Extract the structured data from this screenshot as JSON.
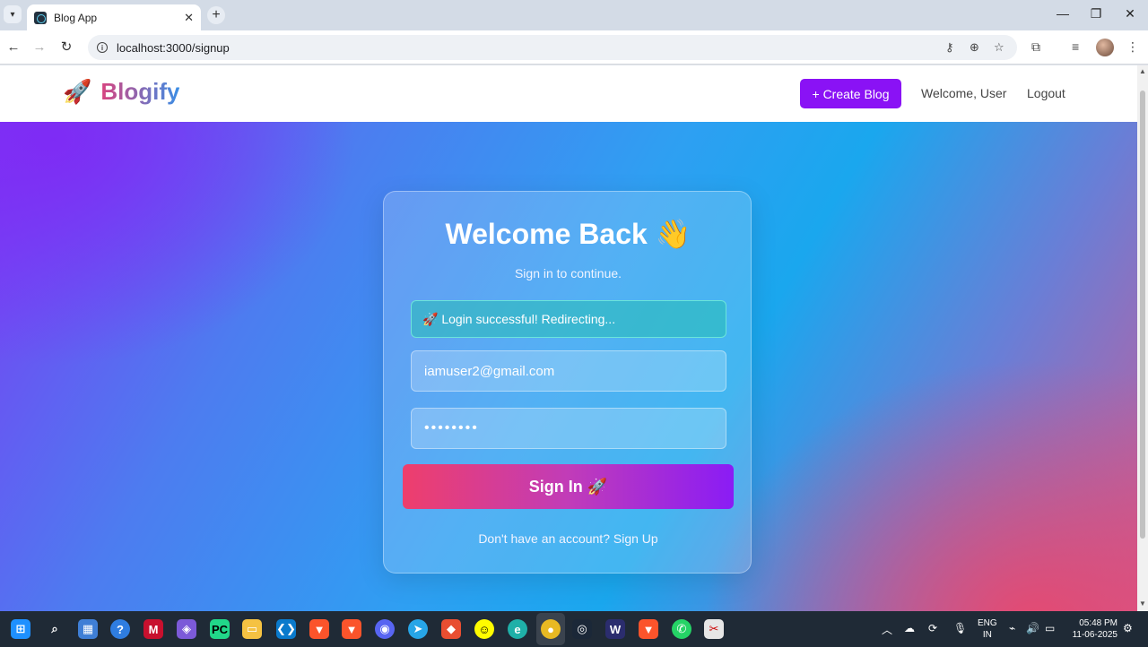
{
  "browser": {
    "tab_title": "Blog App",
    "tab_close": "✕",
    "new_tab": "+",
    "url": "localhost:3000/signup",
    "window_controls": {
      "minimize": "—",
      "maximize": "❐",
      "close": "✕"
    }
  },
  "navbar": {
    "logo_icon": "🚀",
    "brand": "Blogify",
    "create_label": "+ Create Blog",
    "welcome": "Welcome, User",
    "logout": "Logout"
  },
  "login": {
    "title": "Welcome Back 👋",
    "subtitle": "Sign in to continue.",
    "alert": "🚀 Login successful! Redirecting...",
    "email_value": "iamuser2@gmail.com",
    "password_value": "••••••••",
    "submit_label": "Sign In 🚀",
    "signup_prompt": "Don't have an account? Sign Up"
  },
  "taskbar": {
    "lang_line1": "ENG",
    "lang_line2": "IN",
    "time": "05:48 PM",
    "date": "11-06-2025"
  },
  "colors": {
    "brand_purple": "#8a12f5",
    "accent_pink": "#ee3e6c",
    "success": "#28beb4"
  }
}
